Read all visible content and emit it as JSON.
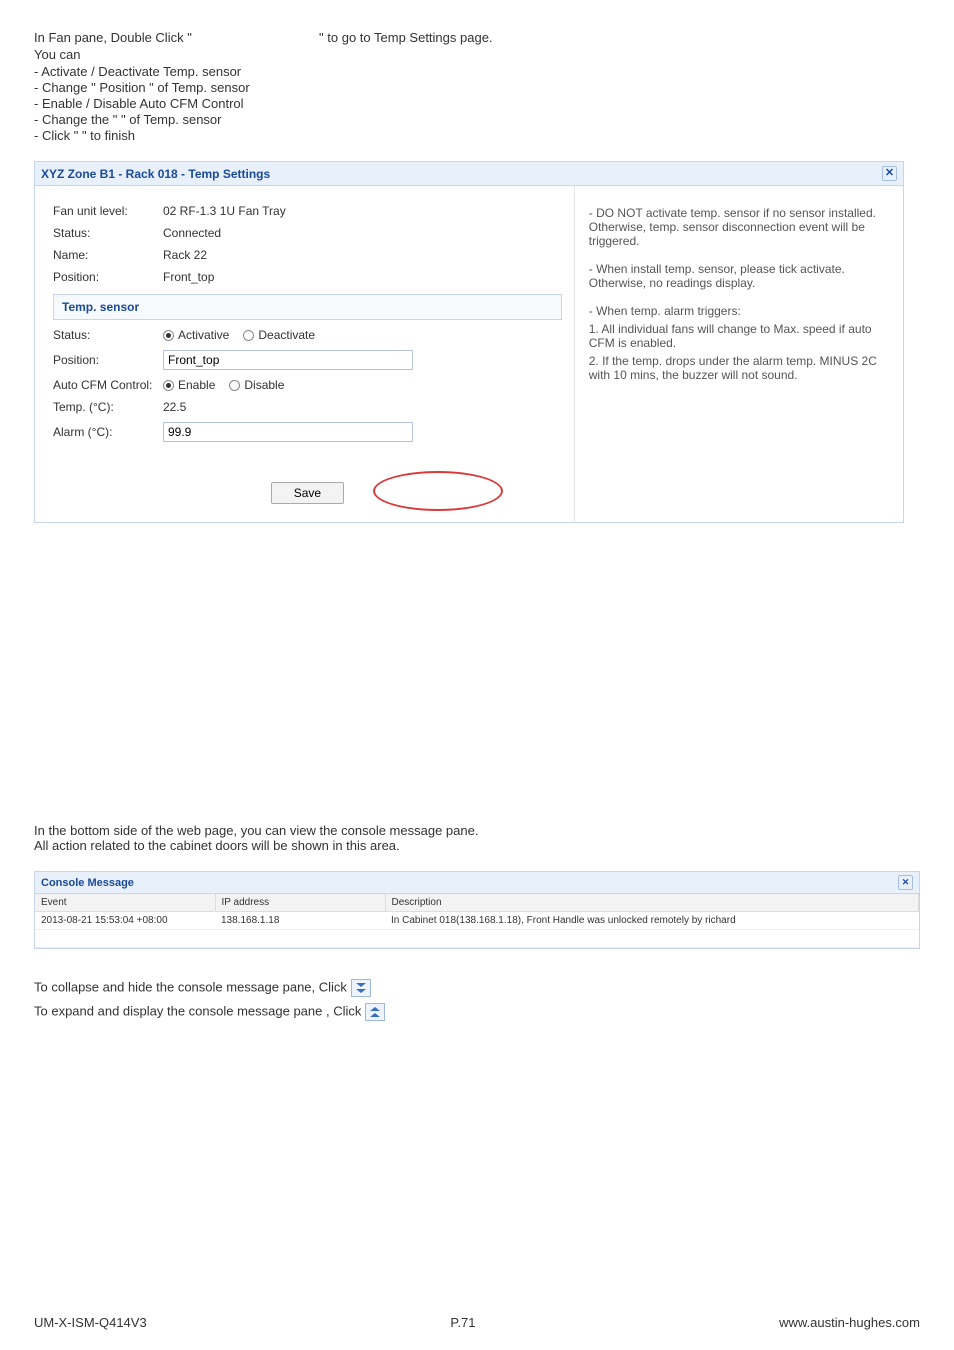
{
  "intro": {
    "prefix": "In Fan pane, Double Click \" ",
    "suffix": " \" to go to Temp Settings page.",
    "line2": "You can"
  },
  "bullets": [
    "-  Activate / Deactivate Temp. sensor",
    "-  Change \" Position \" of Temp. sensor",
    "-  Enable / Disable Auto CFM Control",
    "-  Change the \"           \" of Temp. sensor",
    "-  Click \"          \" to finish"
  ],
  "dialog": {
    "title": "XYZ Zone B1 - Rack 018 - Temp Settings",
    "close": "✕",
    "fields": {
      "fan_unit_level": {
        "label": "Fan unit level:",
        "value": "02 RF-1.3 1U Fan Tray"
      },
      "status": {
        "label": "Status:",
        "value": "Connected"
      },
      "name": {
        "label": "Name:",
        "value": "Rack 22"
      },
      "position": {
        "label": "Position:",
        "value": "Front_top"
      }
    },
    "temp_sensor_header": "Temp. sensor",
    "sensor": {
      "status_label": "Status:",
      "activate": "Activative",
      "deactivate": "Deactivate",
      "position_label": "Position:",
      "position_value": "Front_top",
      "autocfm_label": "Auto CFM Control:",
      "enable": "Enable",
      "disable": "Disable",
      "tempc_label": "Temp. (°C):",
      "tempc_value": "22.5",
      "alarm_label": "Alarm (°C):",
      "alarm_value": "99.9"
    },
    "save": "Save",
    "notes": {
      "n1": "- DO NOT activate temp. sensor if no sensor installed. Otherwise, temp. sensor disconnection event will be triggered.",
      "n2": "- When install temp. sensor, please tick activate. Otherwise, no readings display.",
      "n3": "- When temp. alarm triggers:",
      "n3a": "1. All individual fans will change to Max. speed if auto CFM is enabled.",
      "n3b": "2. If the temp. drops under the alarm temp. MINUS 2C with 10 mins, the buzzer will not sound."
    }
  },
  "paragraph": {
    "l1": "In the bottom side of the web page, you can view the console message pane.",
    "l2": "All action related to the cabinet doors will be shown in this area."
  },
  "console": {
    "title": "Console Message",
    "close": "✕",
    "headers": {
      "event": "Event",
      "ip": "IP address",
      "desc": "Description"
    },
    "row": {
      "event": "2013-08-21 15:53:04 +08:00",
      "ip": "138.168.1.18",
      "desc": "In Cabinet 018(138.168.1.18), Front Handle was unlocked remotely by richard"
    }
  },
  "collapse_line": "To collapse and hide the console message pane, Click ",
  "expand_line": "To expand and display the console message pane , Click ",
  "footer": {
    "left": "UM-X-ISM-Q414V3",
    "center": "P.71",
    "right": "www.austin-hughes.com"
  }
}
